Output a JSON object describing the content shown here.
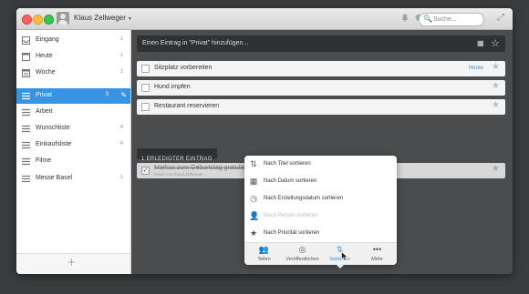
{
  "titlebar": {
    "user_name": "Klaus Zellweger",
    "user_caret": "▾",
    "bell_icon": "bell-icon",
    "chat_icon": "chat-icon",
    "search_placeholder": "Suche...",
    "search_icon": "🔍",
    "fullscreen_icon": "⤢"
  },
  "sidebar": {
    "items": [
      {
        "label": "Eingang",
        "count": "1",
        "icon": "inbox-icon"
      },
      {
        "label": "Heute",
        "count": "1",
        "icon": "calendar-day-icon"
      },
      {
        "label": "Woche",
        "count": "1",
        "icon": "calendar-week-icon"
      },
      {
        "label": "Privat",
        "count": "3",
        "icon": "list-icon"
      },
      {
        "label": "Arbeit",
        "count": "",
        "icon": "list-icon"
      },
      {
        "label": "Wunschliste",
        "count": "4",
        "icon": "list-icon"
      },
      {
        "label": "Einkaufsliste",
        "count": "4",
        "icon": "list-icon"
      },
      {
        "label": "Filme",
        "count": "",
        "icon": "list-icon"
      },
      {
        "label": "Messe Basel",
        "count": "1",
        "icon": "list-icon"
      }
    ],
    "edit_icon": "✎",
    "add_icon": "+"
  },
  "main": {
    "add_placeholder": "Einen Eintrag in \"Privat\" hinzufügen...",
    "add_calendar_icon": "▦",
    "add_star_icon": "☆",
    "tasks": [
      {
        "title": "Sitzplatz vorbereiten",
        "due": "Heute"
      },
      {
        "title": "Hund impfen",
        "due": ""
      },
      {
        "title": "Restaurant reservieren",
        "due": ""
      }
    ],
    "star_icon": "★",
    "done_header": "1 ERLEDIGTER EINTRAG",
    "done_task": {
      "title": "Markus zum Geburtstag gratulieren",
      "subtitle": "Heute von Klaus Zellweger",
      "check": "✓"
    }
  },
  "popup": {
    "items": [
      {
        "label": "Nach Titel sortieren",
        "icon": "⇅",
        "disabled": false
      },
      {
        "label": "Nach Datum sortieren",
        "icon": "▦",
        "disabled": false
      },
      {
        "label": "Nach Erstellungsdatum sortieren",
        "icon": "◷",
        "disabled": false
      },
      {
        "label": "Nach Person sortieren",
        "icon": "👤",
        "disabled": true
      },
      {
        "label": "Nach Priorität sortieren",
        "icon": "★",
        "disabled": false
      }
    ],
    "tabs": [
      {
        "label": "Teilen",
        "icon": "👥"
      },
      {
        "label": "Veröffentlichen",
        "icon": "◎"
      },
      {
        "label": "Sortieren",
        "icon": "⇅"
      },
      {
        "label": "Mehr",
        "icon": "•••"
      }
    ],
    "active_tab": "Sortieren"
  },
  "colors": {
    "accent": "#3793e4",
    "background": "#4a4c4e",
    "sidebar": "#ffffff"
  }
}
